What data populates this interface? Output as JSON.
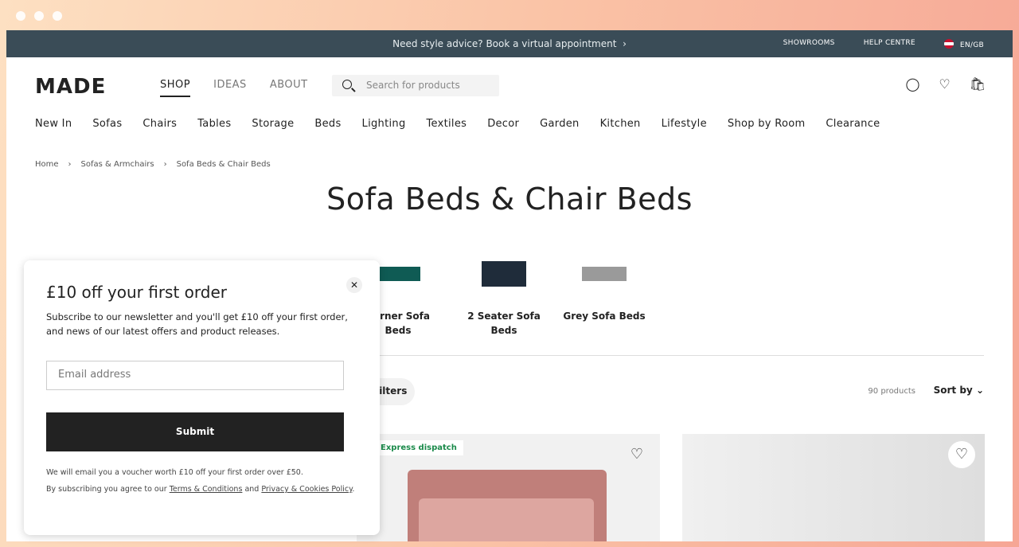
{
  "topbar": {
    "promo": "Need style advice? Book a virtual appointment",
    "links": [
      "SHOWROOMS",
      "HELP CENTRE"
    ],
    "locale": "EN/GB"
  },
  "header": {
    "logo": "MADE",
    "nav": [
      "SHOP",
      "IDEAS",
      "ABOUT"
    ],
    "search_placeholder": "Search for products"
  },
  "categories": [
    "New In",
    "Sofas",
    "Chairs",
    "Tables",
    "Storage",
    "Beds",
    "Lighting",
    "Textiles",
    "Decor",
    "Garden",
    "Kitchen",
    "Lifestyle",
    "Shop by Room",
    "Clearance"
  ],
  "breadcrumb": [
    "Home",
    "Sofas & Armchairs",
    "Sofa Beds & Chair Beds"
  ],
  "page_title": "Sofa Beds & Chair Beds",
  "tiles": [
    {
      "label": "Corner Sofa Beds",
      "color": "#0f5b54"
    },
    {
      "label": "2 Seater Sofa Beds",
      "color": "#1f2c3a"
    },
    {
      "label": "Grey Sofa Beds",
      "color": "#9a9a9a"
    }
  ],
  "toolbar": {
    "filters": "Filters",
    "count": "90 products",
    "sort": "Sort by"
  },
  "products": [
    {
      "badge": "Express dispatch"
    },
    {}
  ],
  "popup": {
    "title": "£10 off your first order",
    "description": "Subscribe to our newsletter and you'll get £10 off your first order, and news of our latest offers and product releases.",
    "email_placeholder": "Email address",
    "submit": "Submit",
    "fine1": "We will email you a voucher worth £10 off your first order over £50.",
    "fine2_prefix": "By subscribing you agree to our",
    "terms": "Terms & Conditions",
    "and": "and",
    "privacy": "Privacy & Cookies Policy"
  }
}
